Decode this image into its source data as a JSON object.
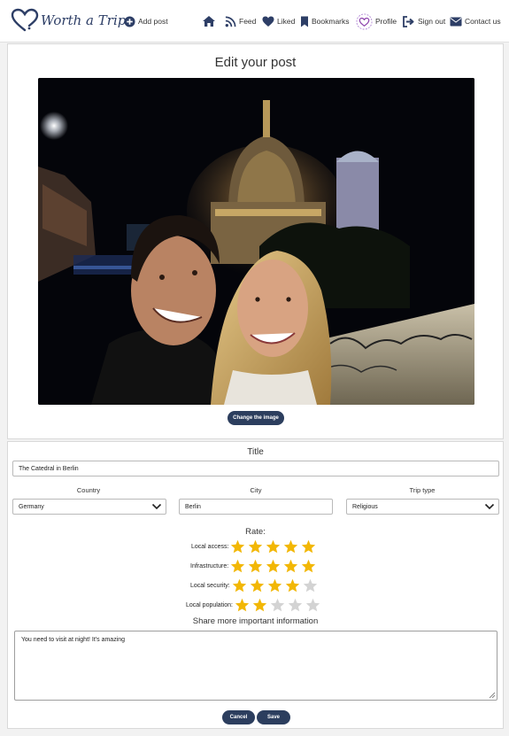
{
  "nav": {
    "brand": "Worth a Trip",
    "add_post": "Add post",
    "feed": "Feed",
    "liked": "Liked",
    "bookmarks": "Bookmarks",
    "profile": "Profile",
    "sign_out": "Sign out",
    "contact": "Contact us"
  },
  "post": {
    "page_title": "Edit your post",
    "change_image": "Change the image",
    "title_label": "Title",
    "title_value": "The Catedral in Berlin",
    "country_label": "Country",
    "country_value": "Germany",
    "city_label": "City",
    "city_value": "Berlin",
    "trip_type_label": "Trip type",
    "trip_type_value": "Religious",
    "rate_label": "Rate:",
    "ratings": [
      {
        "label": "Local access:",
        "value": 5
      },
      {
        "label": "Infrastructure:",
        "value": 5
      },
      {
        "label": "Local security:",
        "value": 4
      },
      {
        "label": "Local population:",
        "value": 2
      }
    ],
    "share_label": "Share more important information",
    "info_value": "You need to visit at night! It's amazing",
    "cancel": "Cancel",
    "save": "Save"
  },
  "colors": {
    "brand": "#2d3e66",
    "star_filled": "#f2b705",
    "star_empty": "#d3d3d3",
    "button": "#2c3e5e"
  }
}
